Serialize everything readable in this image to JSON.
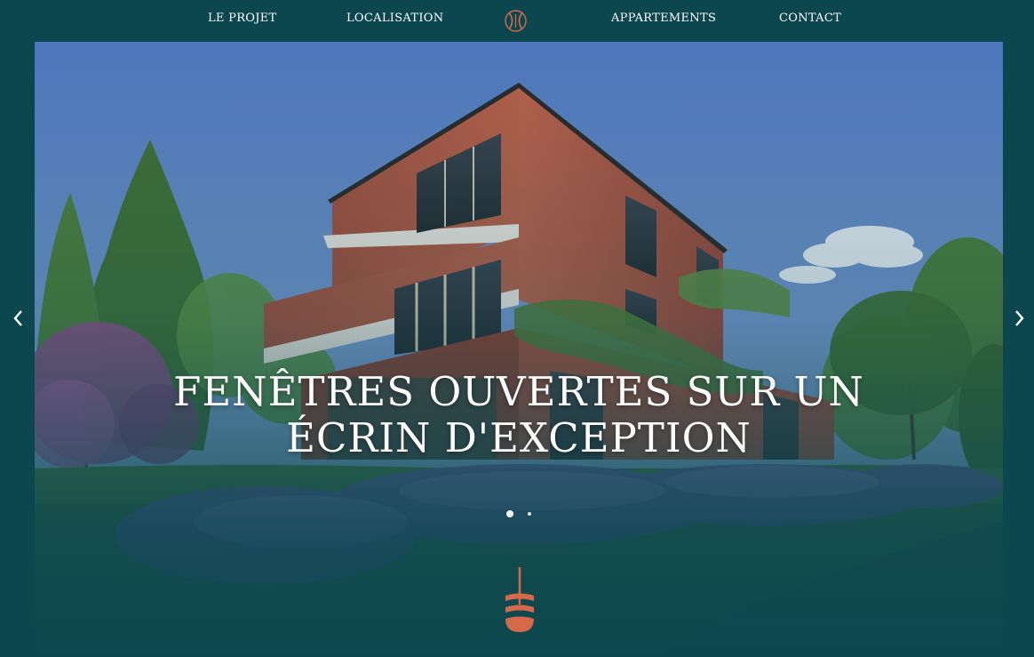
{
  "nav": {
    "links": [
      {
        "label": "LE PROJET"
      },
      {
        "label": "LOCALISATION"
      },
      {
        "label": "APPARTEMENTS"
      },
      {
        "label": "CONTACT"
      }
    ],
    "logo_icon": "monogram-logo-icon"
  },
  "hero": {
    "title_line1": "FENÊTRES OUVERTES SUR UN",
    "title_line2": "ÉCRIN D'EXCEPTION",
    "slide_count": 2,
    "active_slide": 1
  },
  "icons": {
    "prev": "chevron-left-icon",
    "next": "chevron-right-icon",
    "scroll": "scroll-down-icon"
  },
  "colors": {
    "background": "#0c4750",
    "accent": "#d5694a",
    "text": "#ffffff"
  }
}
